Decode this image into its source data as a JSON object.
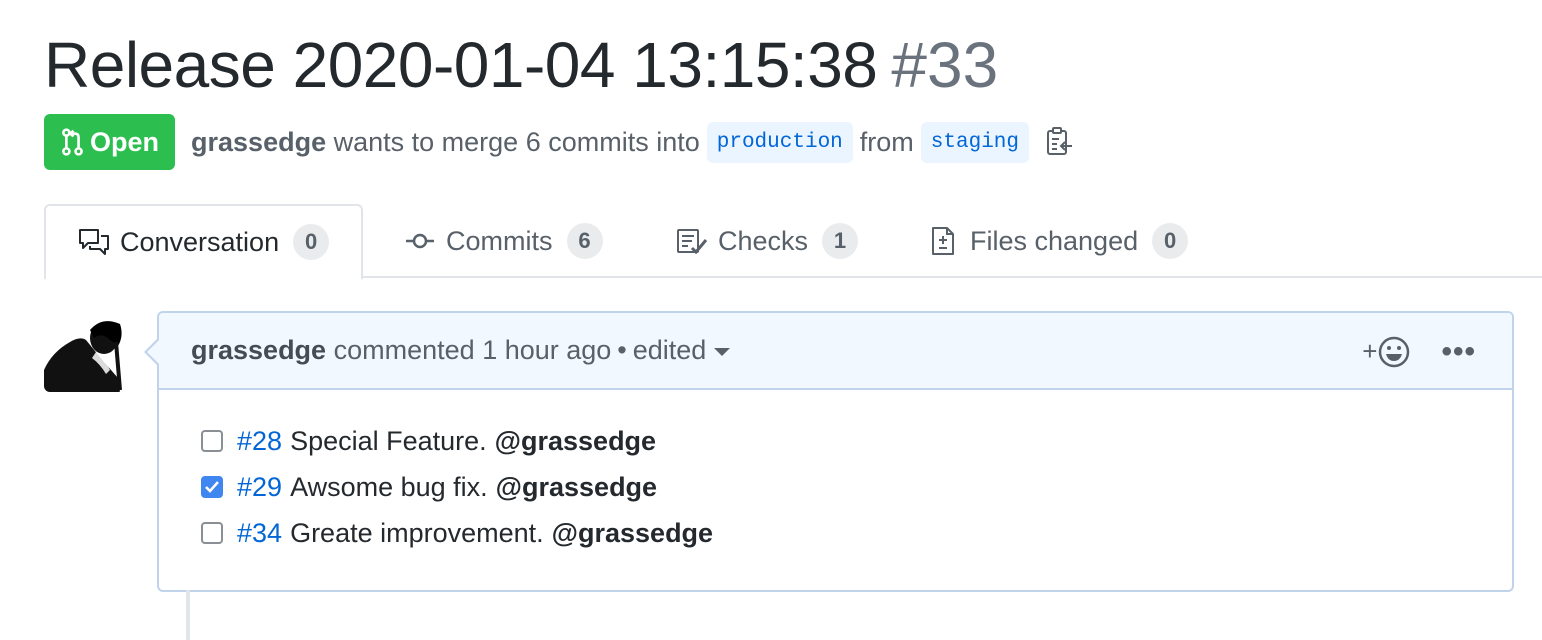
{
  "pull_request": {
    "title": "Release 2020-01-04 13:15:38",
    "number": "#33",
    "state": "Open",
    "author": "grassedge",
    "merge_text": "wants to merge 6 commits into",
    "base_branch": "production",
    "from_text": "from",
    "head_branch": "staging"
  },
  "tabs": [
    {
      "label": "Conversation",
      "count": "0",
      "icon": "comment-discussion-icon",
      "selected": true
    },
    {
      "label": "Commits",
      "count": "6",
      "icon": "commit-icon",
      "selected": false
    },
    {
      "label": "Checks",
      "count": "1",
      "icon": "checklist-icon",
      "selected": false
    },
    {
      "label": "Files changed",
      "count": "0",
      "icon": "file-diff-icon",
      "selected": false
    }
  ],
  "comment": {
    "author": "grassedge",
    "action": "commented",
    "time": "1 hour ago",
    "separator": "•",
    "edited": "edited",
    "react_plus": "+",
    "more": "•••",
    "tasks": [
      {
        "ref": "#28",
        "text": "Special Feature.",
        "mention": "@grassedge",
        "checked": false
      },
      {
        "ref": "#29",
        "text": "Awsome bug fix.",
        "mention": "@grassedge",
        "checked": true
      },
      {
        "ref": "#34",
        "text": "Greate improvement.",
        "mention": "@grassedge",
        "checked": false
      }
    ]
  },
  "colors": {
    "open_badge": "#2cbe4e",
    "link": "#0366d6",
    "header_bg": "#f1f8ff",
    "checkbox_checked": "#3f86f0"
  }
}
